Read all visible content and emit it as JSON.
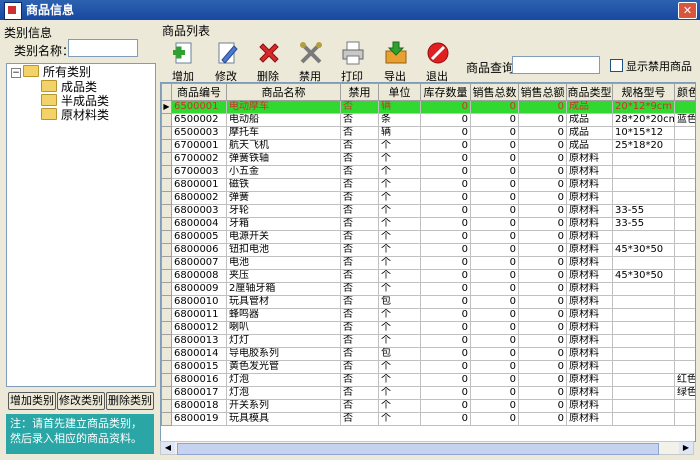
{
  "window": {
    "title": "商品信息"
  },
  "category_panel": {
    "header": "类别信息",
    "name_label": "类别名称：",
    "tree": [
      {
        "label": "所有类别",
        "expander": "−"
      },
      {
        "label": "成品类"
      },
      {
        "label": "半成品类"
      },
      {
        "label": "原材料类"
      }
    ],
    "buttons": [
      "增加类别",
      "修改类别",
      "删除类别"
    ],
    "note": "注：请首先建立商品类别，然后录入相应的商品资料。"
  },
  "product_panel": {
    "header": "商品列表",
    "toolbar": [
      {
        "label": "增加",
        "icon": "add-document-icon"
      },
      {
        "label": "修改",
        "icon": "edit-document-icon"
      },
      {
        "label": "删除",
        "icon": "delete-x-icon"
      },
      {
        "label": "禁用",
        "icon": "disable-tools-icon"
      },
      {
        "label": "打印",
        "icon": "printer-icon"
      },
      {
        "label": "导出",
        "icon": "export-icon"
      },
      {
        "label": "退出",
        "icon": "exit-icon"
      }
    ],
    "search_label": "商品查询：",
    "show_disabled_label": "显示禁用商品"
  },
  "table": {
    "columns": [
      "商品编号",
      "商品名称",
      "禁用",
      "单位",
      "库存数量",
      "销售总数",
      "销售总额",
      "商品类型",
      "规格型号",
      "颜色"
    ],
    "rows": [
      [
        "6500001",
        "电动摩车",
        "否",
        "辆",
        "0",
        "0",
        "0",
        "成品",
        "20*12*9cm",
        ""
      ],
      [
        "6500002",
        "电动船",
        "否",
        "条",
        "0",
        "0",
        "0",
        "成品",
        "28*20*20cm",
        "蓝色"
      ],
      [
        "6500003",
        "摩托车",
        "否",
        "辆",
        "0",
        "0",
        "0",
        "成品",
        "10*15*12",
        ""
      ],
      [
        "6700001",
        "航天飞机",
        "否",
        "个",
        "0",
        "0",
        "0",
        "成品",
        "25*18*20",
        ""
      ],
      [
        "6700002",
        "弹簧铁轴",
        "否",
        "个",
        "0",
        "0",
        "0",
        "原材料",
        "",
        ""
      ],
      [
        "6700003",
        "小五金",
        "否",
        "个",
        "0",
        "0",
        "0",
        "原材料",
        "",
        ""
      ],
      [
        "6800001",
        "磁铁",
        "否",
        "个",
        "0",
        "0",
        "0",
        "原材料",
        "",
        ""
      ],
      [
        "6800002",
        "弹簧",
        "否",
        "个",
        "0",
        "0",
        "0",
        "原材料",
        "",
        ""
      ],
      [
        "6800003",
        "牙轮",
        "否",
        "个",
        "0",
        "0",
        "0",
        "原材料",
        "33-55",
        ""
      ],
      [
        "6800004",
        "牙箱",
        "否",
        "个",
        "0",
        "0",
        "0",
        "原材料",
        "33-55",
        ""
      ],
      [
        "6800005",
        "电源开关",
        "否",
        "个",
        "0",
        "0",
        "0",
        "原材料",
        "",
        ""
      ],
      [
        "6800006",
        "钮扣电池",
        "否",
        "个",
        "0",
        "0",
        "0",
        "原材料",
        "45*30*50",
        ""
      ],
      [
        "6800007",
        "电池",
        "否",
        "个",
        "0",
        "0",
        "0",
        "原材料",
        "",
        ""
      ],
      [
        "6800008",
        "夹压",
        "否",
        "个",
        "0",
        "0",
        "0",
        "原材料",
        "45*30*50",
        ""
      ],
      [
        "6800009",
        "2厘轴牙箱",
        "否",
        "个",
        "0",
        "0",
        "0",
        "原材料",
        "",
        ""
      ],
      [
        "6800010",
        "玩具管材",
        "否",
        "包",
        "0",
        "0",
        "0",
        "原材料",
        "",
        ""
      ],
      [
        "6800011",
        "蜂鸣器",
        "否",
        "个",
        "0",
        "0",
        "0",
        "原材料",
        "",
        ""
      ],
      [
        "6800012",
        "喇叭",
        "否",
        "个",
        "0",
        "0",
        "0",
        "原材料",
        "",
        ""
      ],
      [
        "6800013",
        "灯灯",
        "否",
        "个",
        "0",
        "0",
        "0",
        "原材料",
        "",
        ""
      ],
      [
        "6800014",
        "导电胶系列",
        "否",
        "包",
        "0",
        "0",
        "0",
        "原材料",
        "",
        ""
      ],
      [
        "6800015",
        "黄色发光管",
        "否",
        "个",
        "0",
        "0",
        "0",
        "原材料",
        "",
        ""
      ],
      [
        "6800016",
        "灯泡",
        "否",
        "个",
        "0",
        "0",
        "0",
        "原材料",
        "",
        "红色"
      ],
      [
        "6800017",
        "灯泡",
        "否",
        "个",
        "0",
        "0",
        "0",
        "原材料",
        "",
        "绿色"
      ],
      [
        "6800018",
        "开关系列",
        "否",
        "个",
        "0",
        "0",
        "0",
        "原材料",
        "",
        ""
      ],
      [
        "6800019",
        "玩具模具",
        "否",
        "个",
        "0",
        "0",
        "0",
        "原材料",
        "",
        ""
      ]
    ]
  },
  "colors": {
    "title_bar": "#1847a0",
    "selected_row": "#30d830",
    "selected_text": "#d03030",
    "note_bg": "#2ba6a6"
  }
}
